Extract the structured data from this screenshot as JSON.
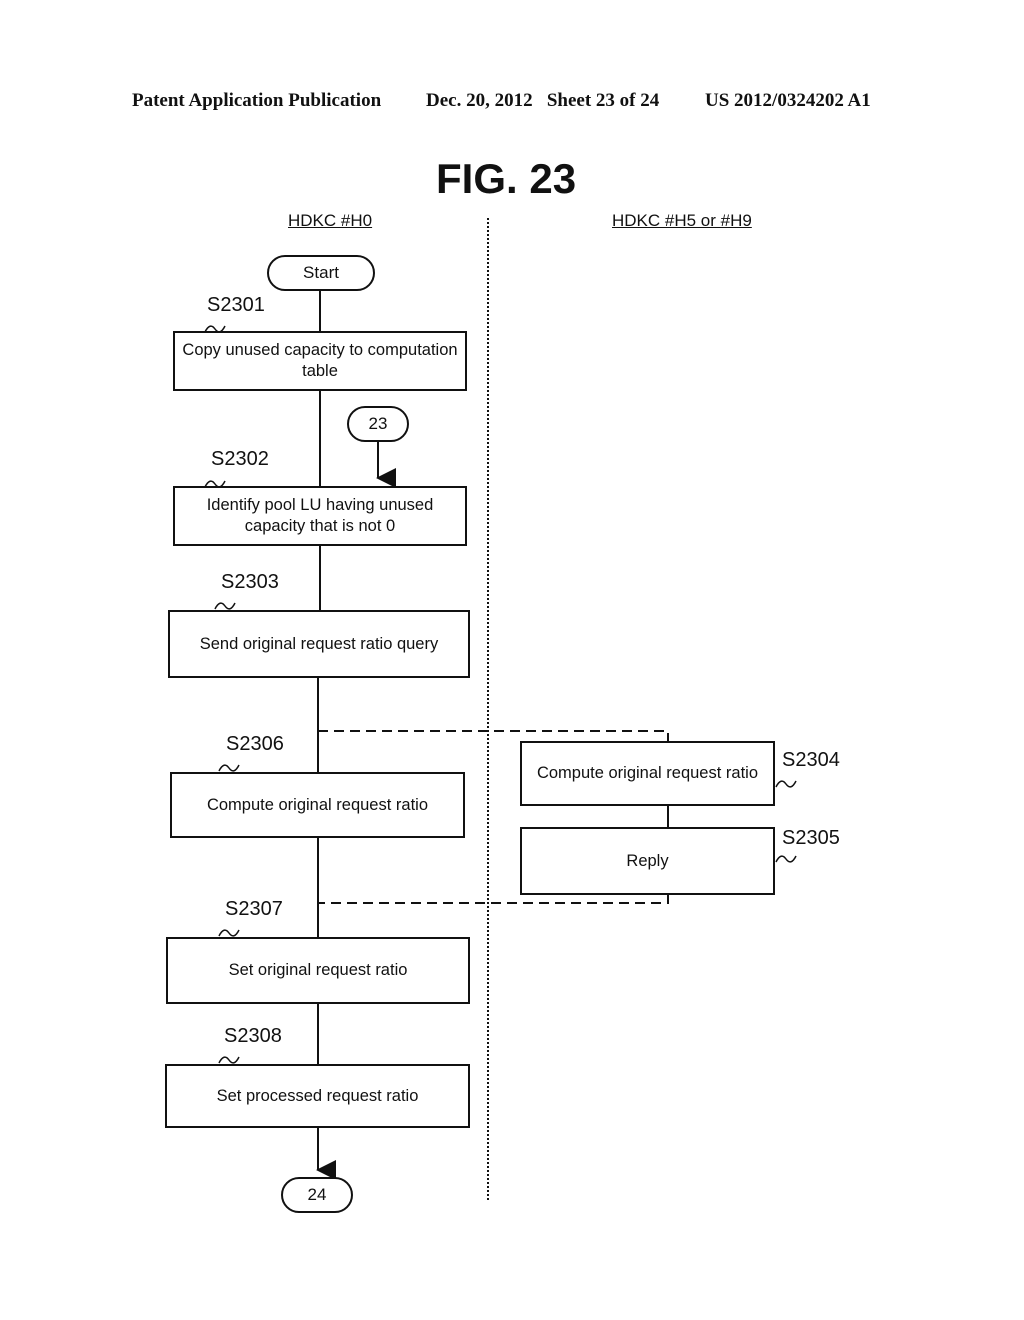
{
  "header": {
    "left": "Patent Application Publication",
    "middle": "Dec. 20, 2012   Sheet 23 of 24",
    "right": "US 2012/0324202 A1"
  },
  "figure_title": "FIG. 23",
  "lanes": {
    "left": "HDKC #H0",
    "right": "HDKC #H5 or #H9"
  },
  "terminals": {
    "start": "Start",
    "connector_in": "23",
    "connector_out": "24"
  },
  "steps": [
    {
      "id": "S2301",
      "text": "Copy unused capacity to computation table"
    },
    {
      "id": "S2302",
      "text": "Identify pool LU having unused capacity that is not 0"
    },
    {
      "id": "S2303",
      "text": "Send original request ratio query"
    },
    {
      "id": "S2304",
      "text": "Compute original request ratio"
    },
    {
      "id": "S2305",
      "text": "Reply"
    },
    {
      "id": "S2306",
      "text": "Compute original request ratio"
    },
    {
      "id": "S2307",
      "text": "Set original request ratio"
    },
    {
      "id": "S2308",
      "text": "Set processed request ratio"
    }
  ]
}
